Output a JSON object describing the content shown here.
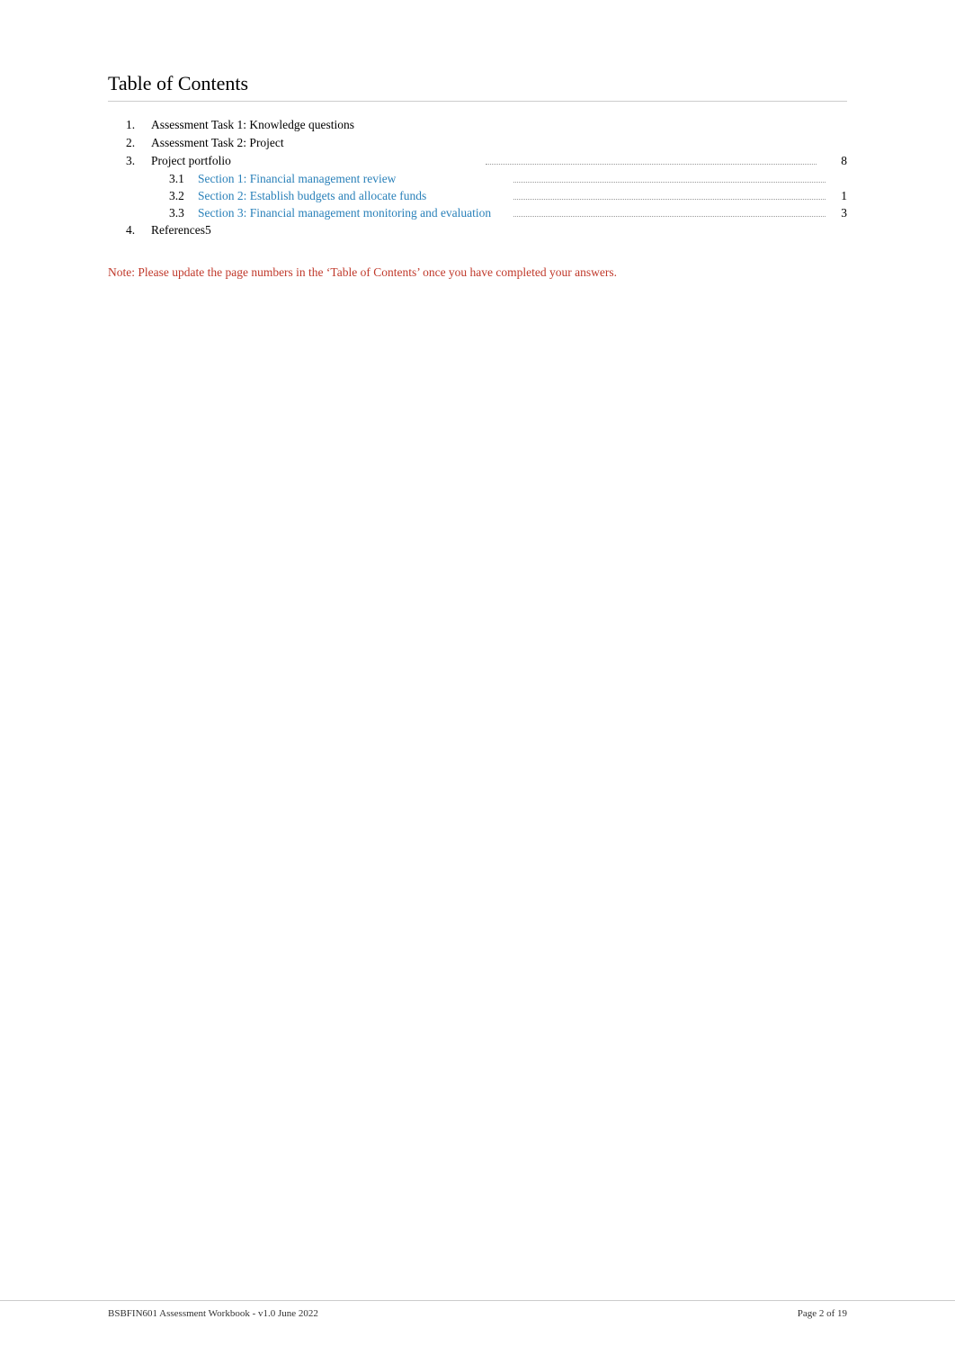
{
  "page": {
    "title": "Table of Contents",
    "items": [
      {
        "number": "1.",
        "label": "Assessment Task 1: Knowledge questions",
        "page": ""
      },
      {
        "number": "2.",
        "label": "Assessment Task 2: Project",
        "page": ""
      },
      {
        "number": "3.",
        "label": "Project portfolio",
        "page": "8"
      }
    ],
    "subitems": [
      {
        "number": "3.1",
        "label": "Section 1: Financial management review",
        "page": ""
      },
      {
        "number": "3.2",
        "label": "Section 2: Establish budgets and allocate funds",
        "page": "1"
      },
      {
        "number": "3.3",
        "label": "Section 3: Financial management monitoring and evaluation",
        "page": "3"
      }
    ],
    "item4": {
      "number": "4.",
      "label": "References5",
      "page": ""
    },
    "note": "Note: Please update the page numbers in the ‘Table of Contents’ once you have completed your answers."
  },
  "footer": {
    "left": "BSBFIN601 Assessment Workbook - v1.0 June 2022",
    "right": "Page  2  of 19"
  }
}
